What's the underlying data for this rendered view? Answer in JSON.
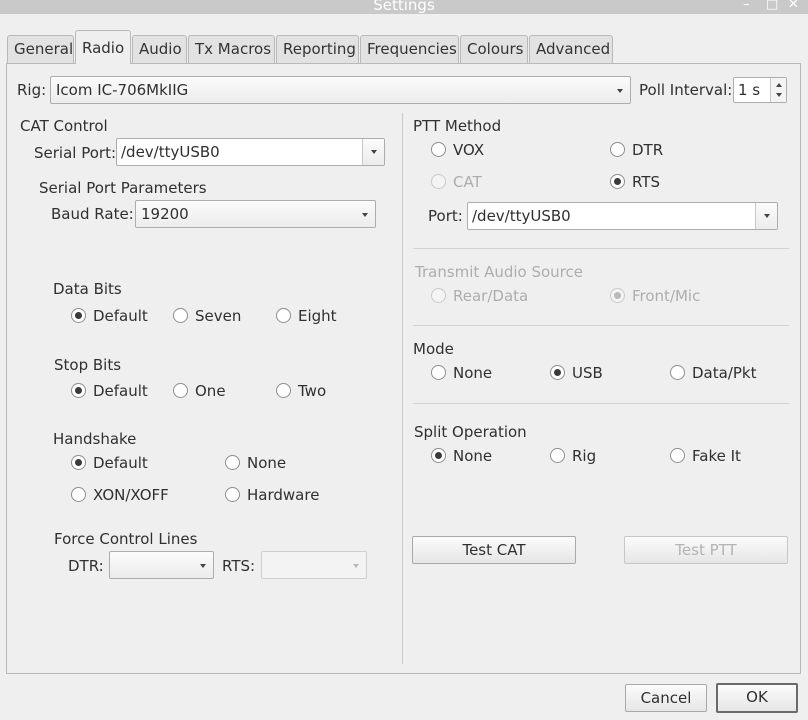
{
  "window": {
    "title": "Settings",
    "minimize": "–",
    "maximize": "□",
    "close": "✕"
  },
  "tabs": [
    "General",
    "Radio",
    "Audio",
    "Tx Macros",
    "Reporting",
    "Frequencies",
    "Colours",
    "Advanced"
  ],
  "rig": {
    "label": "Rig:",
    "value": "Icom IC-706MkIIG"
  },
  "poll": {
    "label": "Poll Interval:",
    "value": "1 s"
  },
  "cat": {
    "title": "CAT Control",
    "serial_label": "Serial Port:",
    "serial_value": "/dev/ttyUSB0",
    "params_title": "Serial Port Parameters",
    "baud_label": "Baud Rate:",
    "baud_value": "19200",
    "data_bits": {
      "title": "Data Bits",
      "options": [
        "Default",
        "Seven",
        "Eight"
      ]
    },
    "stop_bits": {
      "title": "Stop Bits",
      "options": [
        "Default",
        "One",
        "Two"
      ]
    },
    "handshake": {
      "title": "Handshake",
      "options": [
        "Default",
        "None",
        "XON/XOFF",
        "Hardware"
      ]
    },
    "force": {
      "title": "Force Control Lines",
      "dtr_label": "DTR:",
      "rts_label": "RTS:"
    }
  },
  "ptt": {
    "title": "PTT Method",
    "options": [
      "VOX",
      "DTR",
      "CAT",
      "RTS"
    ],
    "port_label": "Port:",
    "port_value": "/dev/ttyUSB0"
  },
  "tx_audio": {
    "title": "Transmit Audio Source",
    "options": [
      "Rear/Data",
      "Front/Mic"
    ]
  },
  "mode": {
    "title": "Mode",
    "options": [
      "None",
      "USB",
      "Data/Pkt"
    ]
  },
  "split": {
    "title": "Split Operation",
    "options": [
      "None",
      "Rig",
      "Fake It"
    ]
  },
  "buttons": {
    "test_cat": "Test CAT",
    "test_ptt": "Test PTT",
    "cancel": "Cancel",
    "ok": "OK"
  }
}
